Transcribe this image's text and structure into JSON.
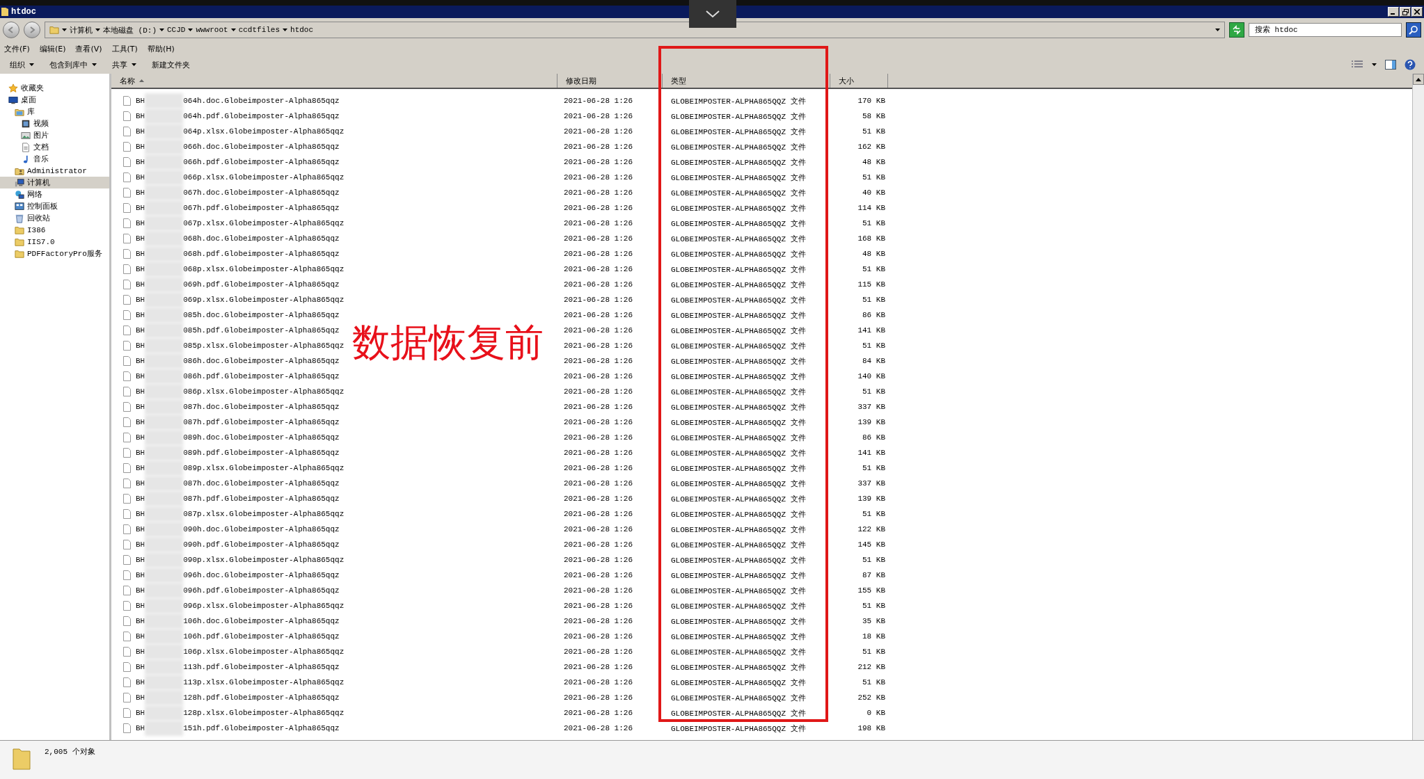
{
  "window": {
    "title": "htdoc"
  },
  "address": {
    "segments": [
      "计算机",
      "本地磁盘 (D:)",
      "CCJD",
      "wwwroot",
      "ccdtfiles",
      "htdoc"
    ]
  },
  "search": {
    "placeholder": "搜索 htdoc"
  },
  "menu": [
    "文件(F)",
    "编辑(E)",
    "查看(V)",
    "工具(T)",
    "帮助(H)"
  ],
  "toolbar": [
    {
      "label": "组织",
      "dropdown": true
    },
    {
      "label": "包含到库中",
      "dropdown": true
    },
    {
      "label": "共享",
      "dropdown": true
    },
    {
      "label": "新建文件夹",
      "dropdown": false
    }
  ],
  "sidebar": {
    "items": [
      {
        "label": "收藏夹",
        "selected": false
      },
      {
        "label": "桌面",
        "selected": false,
        "children": [
          {
            "label": "库",
            "selected": false,
            "children": [
              {
                "label": "视频",
                "selected": false
              },
              {
                "label": "图片",
                "selected": false
              },
              {
                "label": "文档",
                "selected": false
              },
              {
                "label": "音乐",
                "selected": false
              }
            ]
          },
          {
            "label": "Administrator",
            "selected": false
          },
          {
            "label": "计算机",
            "selected": true
          },
          {
            "label": "网络",
            "selected": false
          },
          {
            "label": "控制面板",
            "selected": false
          },
          {
            "label": "回收站",
            "selected": false
          },
          {
            "label": "I386",
            "selected": false
          },
          {
            "label": "IIS7.0",
            "selected": false
          },
          {
            "label": "PDFFactoryPro服务",
            "selected": false
          }
        ]
      }
    ]
  },
  "columns": [
    {
      "label": "名称",
      "sorted": true
    },
    {
      "label": "修改日期",
      "sorted": false
    },
    {
      "label": "类型",
      "sorted": false
    },
    {
      "label": "大小",
      "sorted": false
    }
  ],
  "rows": [
    {
      "name_start": "BH",
      "name_end": "064h.doc.Globeimposter-Alpha865qqz",
      "modified": "2021-06-28 1:26",
      "type": "GLOBEIMPOSTER-ALPHA865QQZ 文件",
      "size": "170 KB"
    },
    {
      "name_start": "BH",
      "name_end": "064h.pdf.Globeimposter-Alpha865qqz",
      "modified": "2021-06-28 1:26",
      "type": "GLOBEIMPOSTER-ALPHA865QQZ 文件",
      "size": "58 KB"
    },
    {
      "name_start": "BH",
      "name_end": "064p.xlsx.Globeimposter-Alpha865qqz",
      "modified": "2021-06-28 1:26",
      "type": "GLOBEIMPOSTER-ALPHA865QQZ 文件",
      "size": "51 KB"
    },
    {
      "name_start": "BH",
      "name_end": "066h.doc.Globeimposter-Alpha865qqz",
      "modified": "2021-06-28 1:26",
      "type": "GLOBEIMPOSTER-ALPHA865QQZ 文件",
      "size": "162 KB"
    },
    {
      "name_start": "BH",
      "name_end": "066h.pdf.Globeimposter-Alpha865qqz",
      "modified": "2021-06-28 1:26",
      "type": "GLOBEIMPOSTER-ALPHA865QQZ 文件",
      "size": "48 KB"
    },
    {
      "name_start": "BH",
      "name_end": "066p.xlsx.Globeimposter-Alpha865qqz",
      "modified": "2021-06-28 1:26",
      "type": "GLOBEIMPOSTER-ALPHA865QQZ 文件",
      "size": "51 KB"
    },
    {
      "name_start": "BH",
      "name_end": "067h.doc.Globeimposter-Alpha865qqz",
      "modified": "2021-06-28 1:26",
      "type": "GLOBEIMPOSTER-ALPHA865QQZ 文件",
      "size": "40 KB"
    },
    {
      "name_start": "BH",
      "name_end": "067h.pdf.Globeimposter-Alpha865qqz",
      "modified": "2021-06-28 1:26",
      "type": "GLOBEIMPOSTER-ALPHA865QQZ 文件",
      "size": "114 KB"
    },
    {
      "name_start": "BH",
      "name_end": "067p.xlsx.Globeimposter-Alpha865qqz",
      "modified": "2021-06-28 1:26",
      "type": "GLOBEIMPOSTER-ALPHA865QQZ 文件",
      "size": "51 KB"
    },
    {
      "name_start": "BH",
      "name_end": "068h.doc.Globeimposter-Alpha865qqz",
      "modified": "2021-06-28 1:26",
      "type": "GLOBEIMPOSTER-ALPHA865QQZ 文件",
      "size": "168 KB"
    },
    {
      "name_start": "BH",
      "name_end": "068h.pdf.Globeimposter-Alpha865qqz",
      "modified": "2021-06-28 1:26",
      "type": "GLOBEIMPOSTER-ALPHA865QQZ 文件",
      "size": "48 KB"
    },
    {
      "name_start": "BH",
      "name_end": "068p.xlsx.Globeimposter-Alpha865qqz",
      "modified": "2021-06-28 1:26",
      "type": "GLOBEIMPOSTER-ALPHA865QQZ 文件",
      "size": "51 KB"
    },
    {
      "name_start": "BH",
      "name_end": "069h.pdf.Globeimposter-Alpha865qqz",
      "modified": "2021-06-28 1:26",
      "type": "GLOBEIMPOSTER-ALPHA865QQZ 文件",
      "size": "115 KB"
    },
    {
      "name_start": "BH",
      "name_end": "069p.xlsx.Globeimposter-Alpha865qqz",
      "modified": "2021-06-28 1:26",
      "type": "GLOBEIMPOSTER-ALPHA865QQZ 文件",
      "size": "51 KB"
    },
    {
      "name_start": "BH",
      "name_end": "085h.doc.Globeimposter-Alpha865qqz",
      "modified": "2021-06-28 1:26",
      "type": "GLOBEIMPOSTER-ALPHA865QQZ 文件",
      "size": "86 KB"
    },
    {
      "name_start": "BH",
      "name_end": "085h.pdf.Globeimposter-Alpha865qqz",
      "modified": "2021-06-28 1:26",
      "type": "GLOBEIMPOSTER-ALPHA865QQZ 文件",
      "size": "141 KB"
    },
    {
      "name_start": "BH",
      "name_end": "085p.xlsx.Globeimposter-Alpha865qqz",
      "modified": "2021-06-28 1:26",
      "type": "GLOBEIMPOSTER-ALPHA865QQZ 文件",
      "size": "51 KB"
    },
    {
      "name_start": "BH",
      "name_end": "086h.doc.Globeimposter-Alpha865qqz",
      "modified": "2021-06-28 1:26",
      "type": "GLOBEIMPOSTER-ALPHA865QQZ 文件",
      "size": "84 KB"
    },
    {
      "name_start": "BH",
      "name_end": "086h.pdf.Globeimposter-Alpha865qqz",
      "modified": "2021-06-28 1:26",
      "type": "GLOBEIMPOSTER-ALPHA865QQZ 文件",
      "size": "140 KB"
    },
    {
      "name_start": "BH",
      "name_end": "086p.xlsx.Globeimposter-Alpha865qqz",
      "modified": "2021-06-28 1:26",
      "type": "GLOBEIMPOSTER-ALPHA865QQZ 文件",
      "size": "51 KB"
    },
    {
      "name_start": "BH",
      "name_end": "087h.doc.Globeimposter-Alpha865qqz",
      "modified": "2021-06-28 1:26",
      "type": "GLOBEIMPOSTER-ALPHA865QQZ 文件",
      "size": "337 KB"
    },
    {
      "name_start": "BH",
      "name_end": "087h.pdf.Globeimposter-Alpha865qqz",
      "modified": "2021-06-28 1:26",
      "type": "GLOBEIMPOSTER-ALPHA865QQZ 文件",
      "size": "139 KB"
    },
    {
      "name_start": "BH",
      "name_end": "089h.doc.Globeimposter-Alpha865qqz",
      "modified": "2021-06-28 1:26",
      "type": "GLOBEIMPOSTER-ALPHA865QQZ 文件",
      "size": "86 KB"
    },
    {
      "name_start": "BH",
      "name_end": "089h.pdf.Globeimposter-Alpha865qqz",
      "modified": "2021-06-28 1:26",
      "type": "GLOBEIMPOSTER-ALPHA865QQZ 文件",
      "size": "141 KB"
    },
    {
      "name_start": "BH",
      "name_end": "089p.xlsx.Globeimposter-Alpha865qqz",
      "modified": "2021-06-28 1:26",
      "type": "GLOBEIMPOSTER-ALPHA865QQZ 文件",
      "size": "51 KB"
    },
    {
      "name_start": "BH",
      "name_end": "087h.doc.Globeimposter-Alpha865qqz",
      "modified": "2021-06-28 1:26",
      "type": "GLOBEIMPOSTER-ALPHA865QQZ 文件",
      "size": "337 KB"
    },
    {
      "name_start": "BH",
      "name_end": "087h.pdf.Globeimposter-Alpha865qqz",
      "modified": "2021-06-28 1:26",
      "type": "GLOBEIMPOSTER-ALPHA865QQZ 文件",
      "size": "139 KB"
    },
    {
      "name_start": "BH",
      "name_end": "087p.xlsx.Globeimposter-Alpha865qqz",
      "modified": "2021-06-28 1:26",
      "type": "GLOBEIMPOSTER-ALPHA865QQZ 文件",
      "size": "51 KB"
    },
    {
      "name_start": "BH",
      "name_end": "090h.doc.Globeimposter-Alpha865qqz",
      "modified": "2021-06-28 1:26",
      "type": "GLOBEIMPOSTER-ALPHA865QQZ 文件",
      "size": "122 KB"
    },
    {
      "name_start": "BH",
      "name_end": "090h.pdf.Globeimposter-Alpha865qqz",
      "modified": "2021-06-28 1:26",
      "type": "GLOBEIMPOSTER-ALPHA865QQZ 文件",
      "size": "145 KB"
    },
    {
      "name_start": "BH",
      "name_end": "090p.xlsx.Globeimposter-Alpha865qqz",
      "modified": "2021-06-28 1:26",
      "type": "GLOBEIMPOSTER-ALPHA865QQZ 文件",
      "size": "51 KB"
    },
    {
      "name_start": "BH",
      "name_end": "096h.doc.Globeimposter-Alpha865qqz",
      "modified": "2021-06-28 1:26",
      "type": "GLOBEIMPOSTER-ALPHA865QQZ 文件",
      "size": "87 KB"
    },
    {
      "name_start": "BH",
      "name_end": "096h.pdf.Globeimposter-Alpha865qqz",
      "modified": "2021-06-28 1:26",
      "type": "GLOBEIMPOSTER-ALPHA865QQZ 文件",
      "size": "155 KB"
    },
    {
      "name_start": "BH",
      "name_end": "096p.xlsx.Globeimposter-Alpha865qqz",
      "modified": "2021-06-28 1:26",
      "type": "GLOBEIMPOSTER-ALPHA865QQZ 文件",
      "size": "51 KB"
    },
    {
      "name_start": "BH",
      "name_end": "106h.doc.Globeimposter-Alpha865qqz",
      "modified": "2021-06-28 1:26",
      "type": "GLOBEIMPOSTER-ALPHA865QQZ 文件",
      "size": "35 KB"
    },
    {
      "name_start": "BH",
      "name_end": "106h.pdf.Globeimposter-Alpha865qqz",
      "modified": "2021-06-28 1:26",
      "type": "GLOBEIMPOSTER-ALPHA865QQZ 文件",
      "size": "18 KB"
    },
    {
      "name_start": "BH",
      "name_end": "106p.xlsx.Globeimposter-Alpha865qqz",
      "modified": "2021-06-28 1:26",
      "type": "GLOBEIMPOSTER-ALPHA865QQZ 文件",
      "size": "51 KB"
    },
    {
      "name_start": "BH",
      "name_end": "113h.pdf.Globeimposter-Alpha865qqz",
      "modified": "2021-06-28 1:26",
      "type": "GLOBEIMPOSTER-ALPHA865QQZ 文件",
      "size": "212 KB"
    },
    {
      "name_start": "BH",
      "name_end": "113p.xlsx.Globeimposter-Alpha865qqz",
      "modified": "2021-06-28 1:26",
      "type": "GLOBEIMPOSTER-ALPHA865QQZ 文件",
      "size": "51 KB"
    },
    {
      "name_start": "BH",
      "name_end": "128h.pdf.Globeimposter-Alpha865qqz",
      "modified": "2021-06-28 1:26",
      "type": "GLOBEIMPOSTER-ALPHA865QQZ 文件",
      "size": "252 KB"
    },
    {
      "name_start": "BH",
      "name_end": "128p.xlsx.Globeimposter-Alpha865qqz",
      "modified": "2021-06-28 1:26",
      "type": "GLOBEIMPOSTER-ALPHA865QQZ 文件",
      "size": "0 KB"
    },
    {
      "name_start": "BH",
      "name_end": "151h.pdf.Globeimposter-Alpha865qqz",
      "modified": "2021-06-28 1:26",
      "type": "GLOBEIMPOSTER-ALPHA865QQZ 文件",
      "size": "198 KB"
    }
  ],
  "annotation": {
    "text": "数据恢复前"
  },
  "status_bar": {
    "count": "2,005 个对象"
  }
}
